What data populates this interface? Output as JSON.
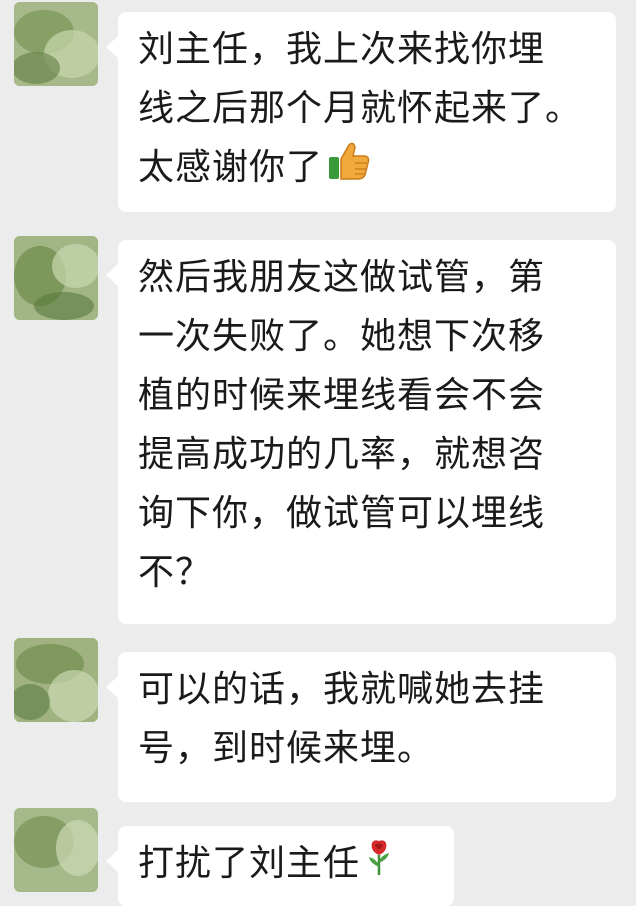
{
  "messages": [
    {
      "lines": [
        "刘主任，我上次来找你埋",
        "线之后那个月就怀起来了。",
        "太感谢你了"
      ],
      "emoji": "thumbs-up-icon"
    },
    {
      "lines": [
        "然后我朋友这做试管，第",
        "一次失败了。她想下次移",
        "植的时候来埋线看会不会",
        "提高成功的几率，就想咨",
        "询下你，做试管可以埋线",
        "不？"
      ]
    },
    {
      "lines": [
        "可以的话，我就喊她去挂",
        "号，到时候来埋。"
      ]
    },
    {
      "lines": [
        "打扰了刘主任"
      ],
      "emoji": "rose-icon"
    }
  ],
  "colors": {
    "background": "#ececec",
    "bubble": "#ffffff",
    "text": "#1a1a1a"
  }
}
